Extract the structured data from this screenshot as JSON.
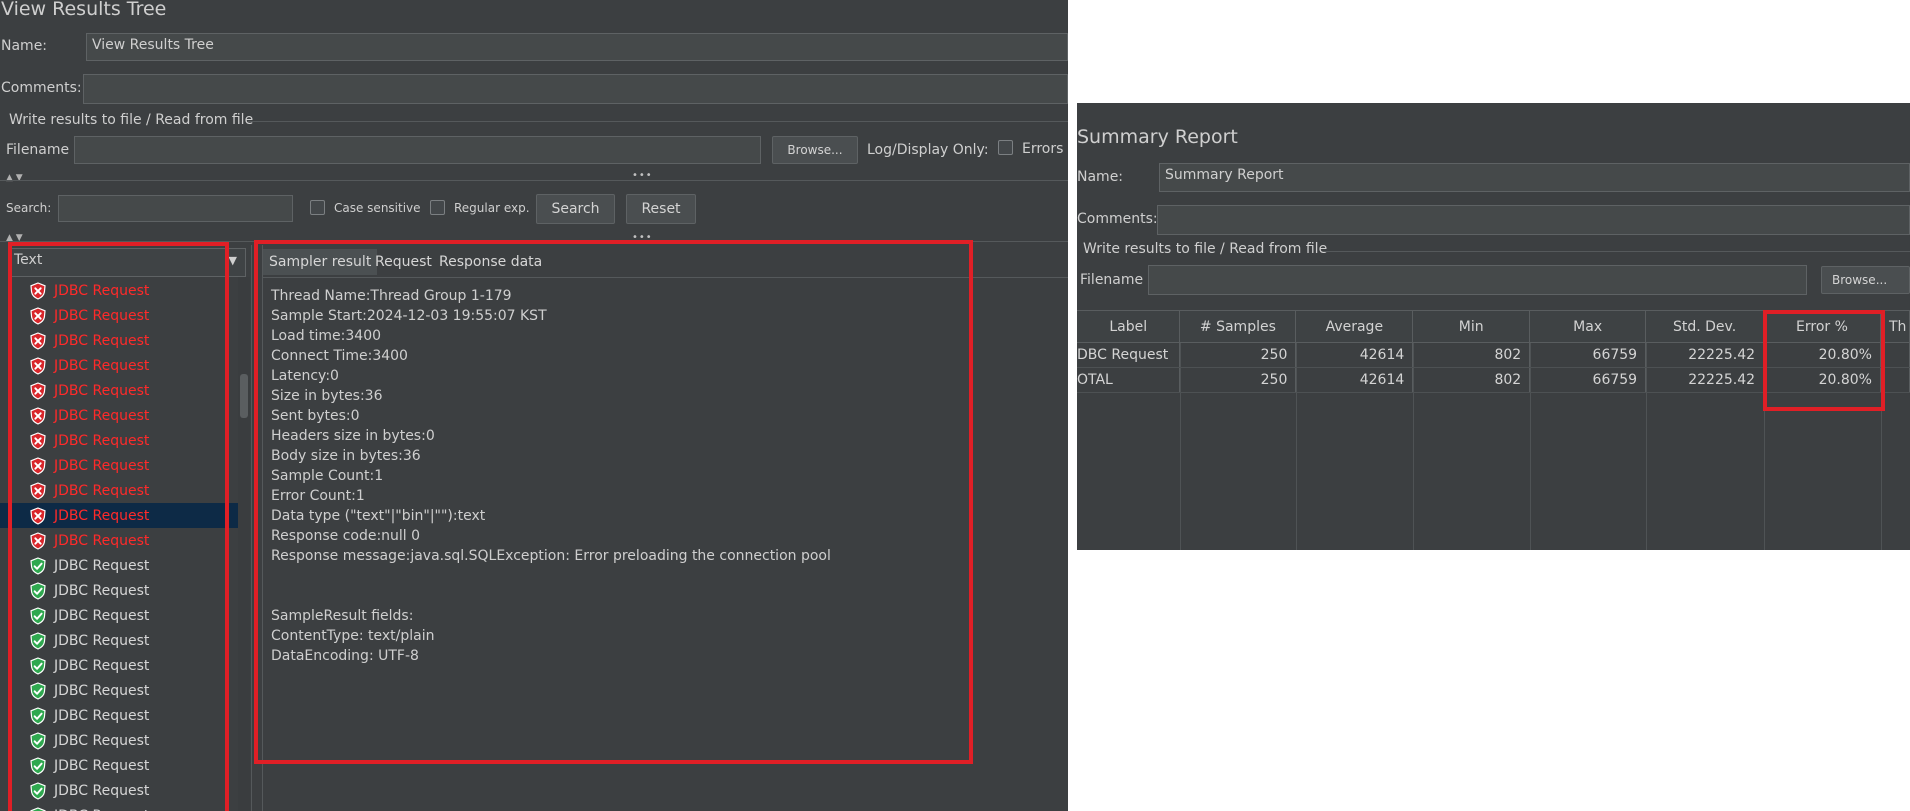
{
  "results_tree": {
    "title": "View Results Tree",
    "name_label": "Name:",
    "name_value": "View Results Tree",
    "comments_label": "Comments:",
    "write_group": "Write results to file / Read from file",
    "filename_label": "Filename",
    "browse_label": "Browse...",
    "log_display_label": "Log/Display Only:",
    "errors_label": "Errors",
    "search_label": "Search:",
    "case_sensitive_label": "Case sensitive",
    "regex_label": "Regular exp.",
    "search_button": "Search",
    "reset_button": "Reset",
    "renderer_selected": "Text",
    "tree_items": [
      {
        "label": "JDBC Request",
        "status": "error"
      },
      {
        "label": "JDBC Request",
        "status": "error"
      },
      {
        "label": "JDBC Request",
        "status": "error"
      },
      {
        "label": "JDBC Request",
        "status": "error"
      },
      {
        "label": "JDBC Request",
        "status": "error"
      },
      {
        "label": "JDBC Request",
        "status": "error"
      },
      {
        "label": "JDBC Request",
        "status": "error"
      },
      {
        "label": "JDBC Request",
        "status": "error"
      },
      {
        "label": "JDBC Request",
        "status": "error"
      },
      {
        "label": "JDBC Request",
        "status": "error"
      },
      {
        "label": "JDBC Request",
        "status": "error"
      },
      {
        "label": "JDBC Request",
        "status": "success"
      },
      {
        "label": "JDBC Request",
        "status": "success"
      },
      {
        "label": "JDBC Request",
        "status": "success"
      },
      {
        "label": "JDBC Request",
        "status": "success"
      },
      {
        "label": "JDBC Request",
        "status": "success"
      },
      {
        "label": "JDBC Request",
        "status": "success"
      },
      {
        "label": "JDBC Request",
        "status": "success"
      },
      {
        "label": "JDBC Request",
        "status": "success"
      },
      {
        "label": "JDBC Request",
        "status": "success"
      },
      {
        "label": "JDBC Request",
        "status": "success"
      },
      {
        "label": "JDBC Request",
        "status": "success"
      }
    ],
    "selected_index": 9,
    "tabs": [
      "Sampler result",
      "Request",
      "Response data"
    ],
    "sampler_lines": [
      "Thread Name:Thread Group 1-179",
      "Sample Start:2024-12-03 19:55:07 KST",
      "Load time:3400",
      "Connect Time:3400",
      "Latency:0",
      "Size in bytes:36",
      "Sent bytes:0",
      "Headers size in bytes:0",
      "Body size in bytes:36",
      "Sample Count:1",
      "Error Count:1",
      "Data type (\"text\"|\"bin\"|\"\"):text",
      "Response code:null 0",
      "Response message:java.sql.SQLException: Error preloading the connection pool",
      "",
      "",
      "SampleResult fields:",
      "ContentType: text/plain",
      "DataEncoding: UTF-8"
    ]
  },
  "summary_report": {
    "title": "Summary Report",
    "name_label": "Name:",
    "name_value": "Summary Report",
    "comments_label": "Comments:",
    "write_group": "Write results to file / Read from file",
    "filename_label": "Filename",
    "browse_label": "Browse...",
    "columns": [
      "Label",
      "# Samples",
      "Average",
      "Min",
      "Max",
      "Std. Dev.",
      "Error %",
      "Th"
    ],
    "rows": [
      [
        "DBC Request",
        "250",
        "42614",
        "802",
        "66759",
        "22225.42",
        "20.80%"
      ],
      [
        "OTAL",
        "250",
        "42614",
        "802",
        "66759",
        "22225.42",
        "20.80%"
      ]
    ]
  },
  "colors": {
    "panel_bg": "#3c3f41",
    "highlight": "#e01f26",
    "error_text": "#ff2a2a",
    "selection": "#0d2a46"
  }
}
